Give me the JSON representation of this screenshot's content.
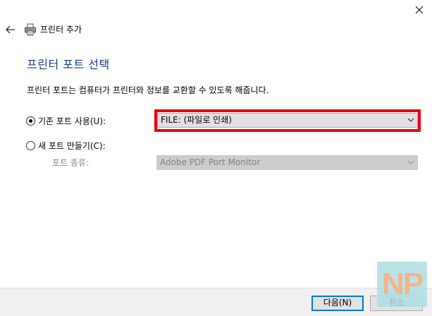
{
  "window": {
    "close_icon": "close-icon"
  },
  "header": {
    "back_icon": "back-arrow-icon",
    "printer_icon": "printer-icon",
    "title": "프린터 추가"
  },
  "page": {
    "title": "프린터 포트 선택",
    "description": "프린터 포트는 컴퓨터가 프린터와 정보를 교환할 수 있도록 해줍니다."
  },
  "options": {
    "existing_port": {
      "label": "기존 포트 사용(U):",
      "checked": true,
      "selected_value": "FILE: (파일로 인쇄)"
    },
    "new_port": {
      "label": "새 포트 만들기(C):",
      "checked": false,
      "port_type_label": "포트 종류:",
      "selected_value": "Adobe PDF Port Monitor"
    }
  },
  "footer": {
    "next_label": "다음(N)",
    "cancel_label": "취소"
  },
  "watermark": {
    "text": "NP"
  },
  "colors": {
    "title_blue": "#1d3d8f",
    "highlight_red": "#e60012",
    "default_button_border": "#0078d7",
    "watermark_bg": "#addee2",
    "watermark_text": "#f6b48a"
  }
}
